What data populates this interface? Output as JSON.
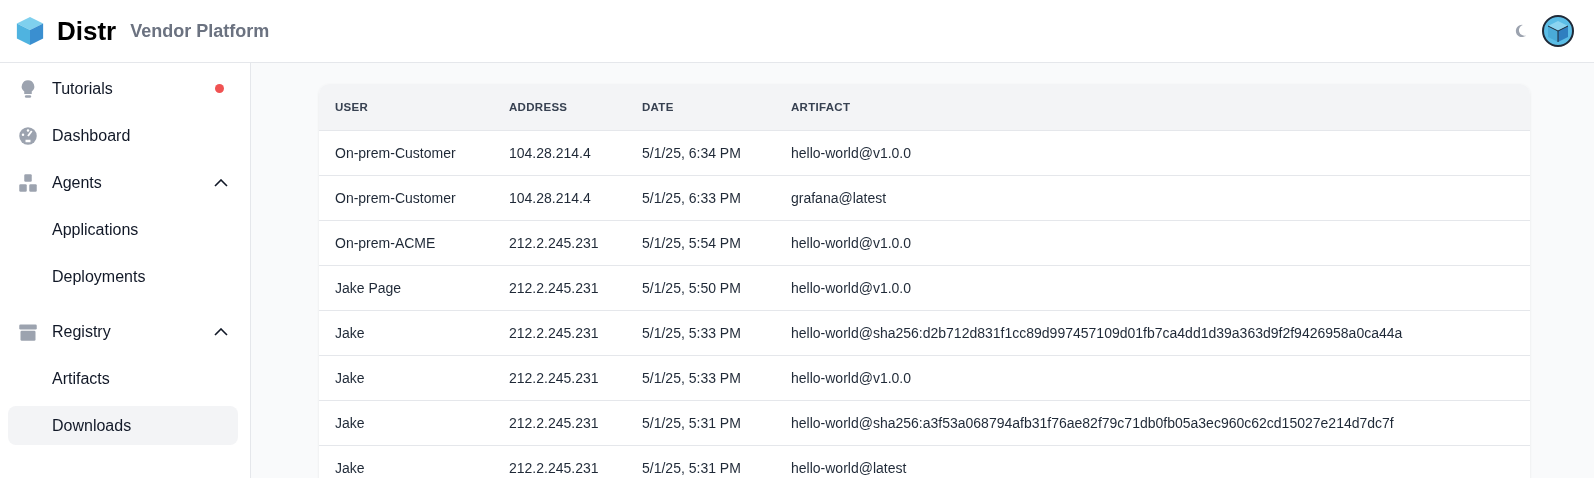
{
  "header": {
    "brand": "Distr",
    "subtitle": "Vendor Platform"
  },
  "sidebar": {
    "items": [
      {
        "label": "Tutorials",
        "notification": true,
        "selected": false
      },
      {
        "label": "Dashboard",
        "notification": false,
        "selected": false
      },
      {
        "label": "Agents",
        "notification": false,
        "selected": false,
        "expanded": true,
        "children": [
          {
            "label": "Applications",
            "selected": false
          },
          {
            "label": "Deployments",
            "selected": false
          }
        ]
      },
      {
        "label": "Registry",
        "notification": false,
        "selected": false,
        "expanded": true,
        "children": [
          {
            "label": "Artifacts",
            "selected": false
          },
          {
            "label": "Downloads",
            "selected": true
          }
        ]
      }
    ]
  },
  "table": {
    "columns": [
      "USER",
      "ADDRESS",
      "DATE",
      "ARTIFACT"
    ],
    "rows": [
      [
        "On-prem-Customer",
        "104.28.214.4",
        "5/1/25, 6:34 PM",
        "hello-world@v1.0.0"
      ],
      [
        "On-prem-Customer",
        "104.28.214.4",
        "5/1/25, 6:33 PM",
        "grafana@latest"
      ],
      [
        "On-prem-ACME",
        "212.2.245.231",
        "5/1/25, 5:54 PM",
        "hello-world@v1.0.0"
      ],
      [
        "Jake Page",
        "212.2.245.231",
        "5/1/25, 5:50 PM",
        "hello-world@v1.0.0"
      ],
      [
        "Jake",
        "212.2.245.231",
        "5/1/25, 5:33 PM",
        "hello-world@sha256:d2b712d831f1cc89d997457109d01fb7ca4dd1d39a363d9f2f9426958a0ca44a"
      ],
      [
        "Jake",
        "212.2.245.231",
        "5/1/25, 5:33 PM",
        "hello-world@v1.0.0"
      ],
      [
        "Jake",
        "212.2.245.231",
        "5/1/25, 5:31 PM",
        "hello-world@sha256:a3f53a068794afb31f76ae82f79c71db0fb05a3ec960c62cd15027e214d7dc7f"
      ],
      [
        "Jake",
        "212.2.245.231",
        "5/1/25, 5:31 PM",
        "hello-world@latest"
      ]
    ]
  }
}
